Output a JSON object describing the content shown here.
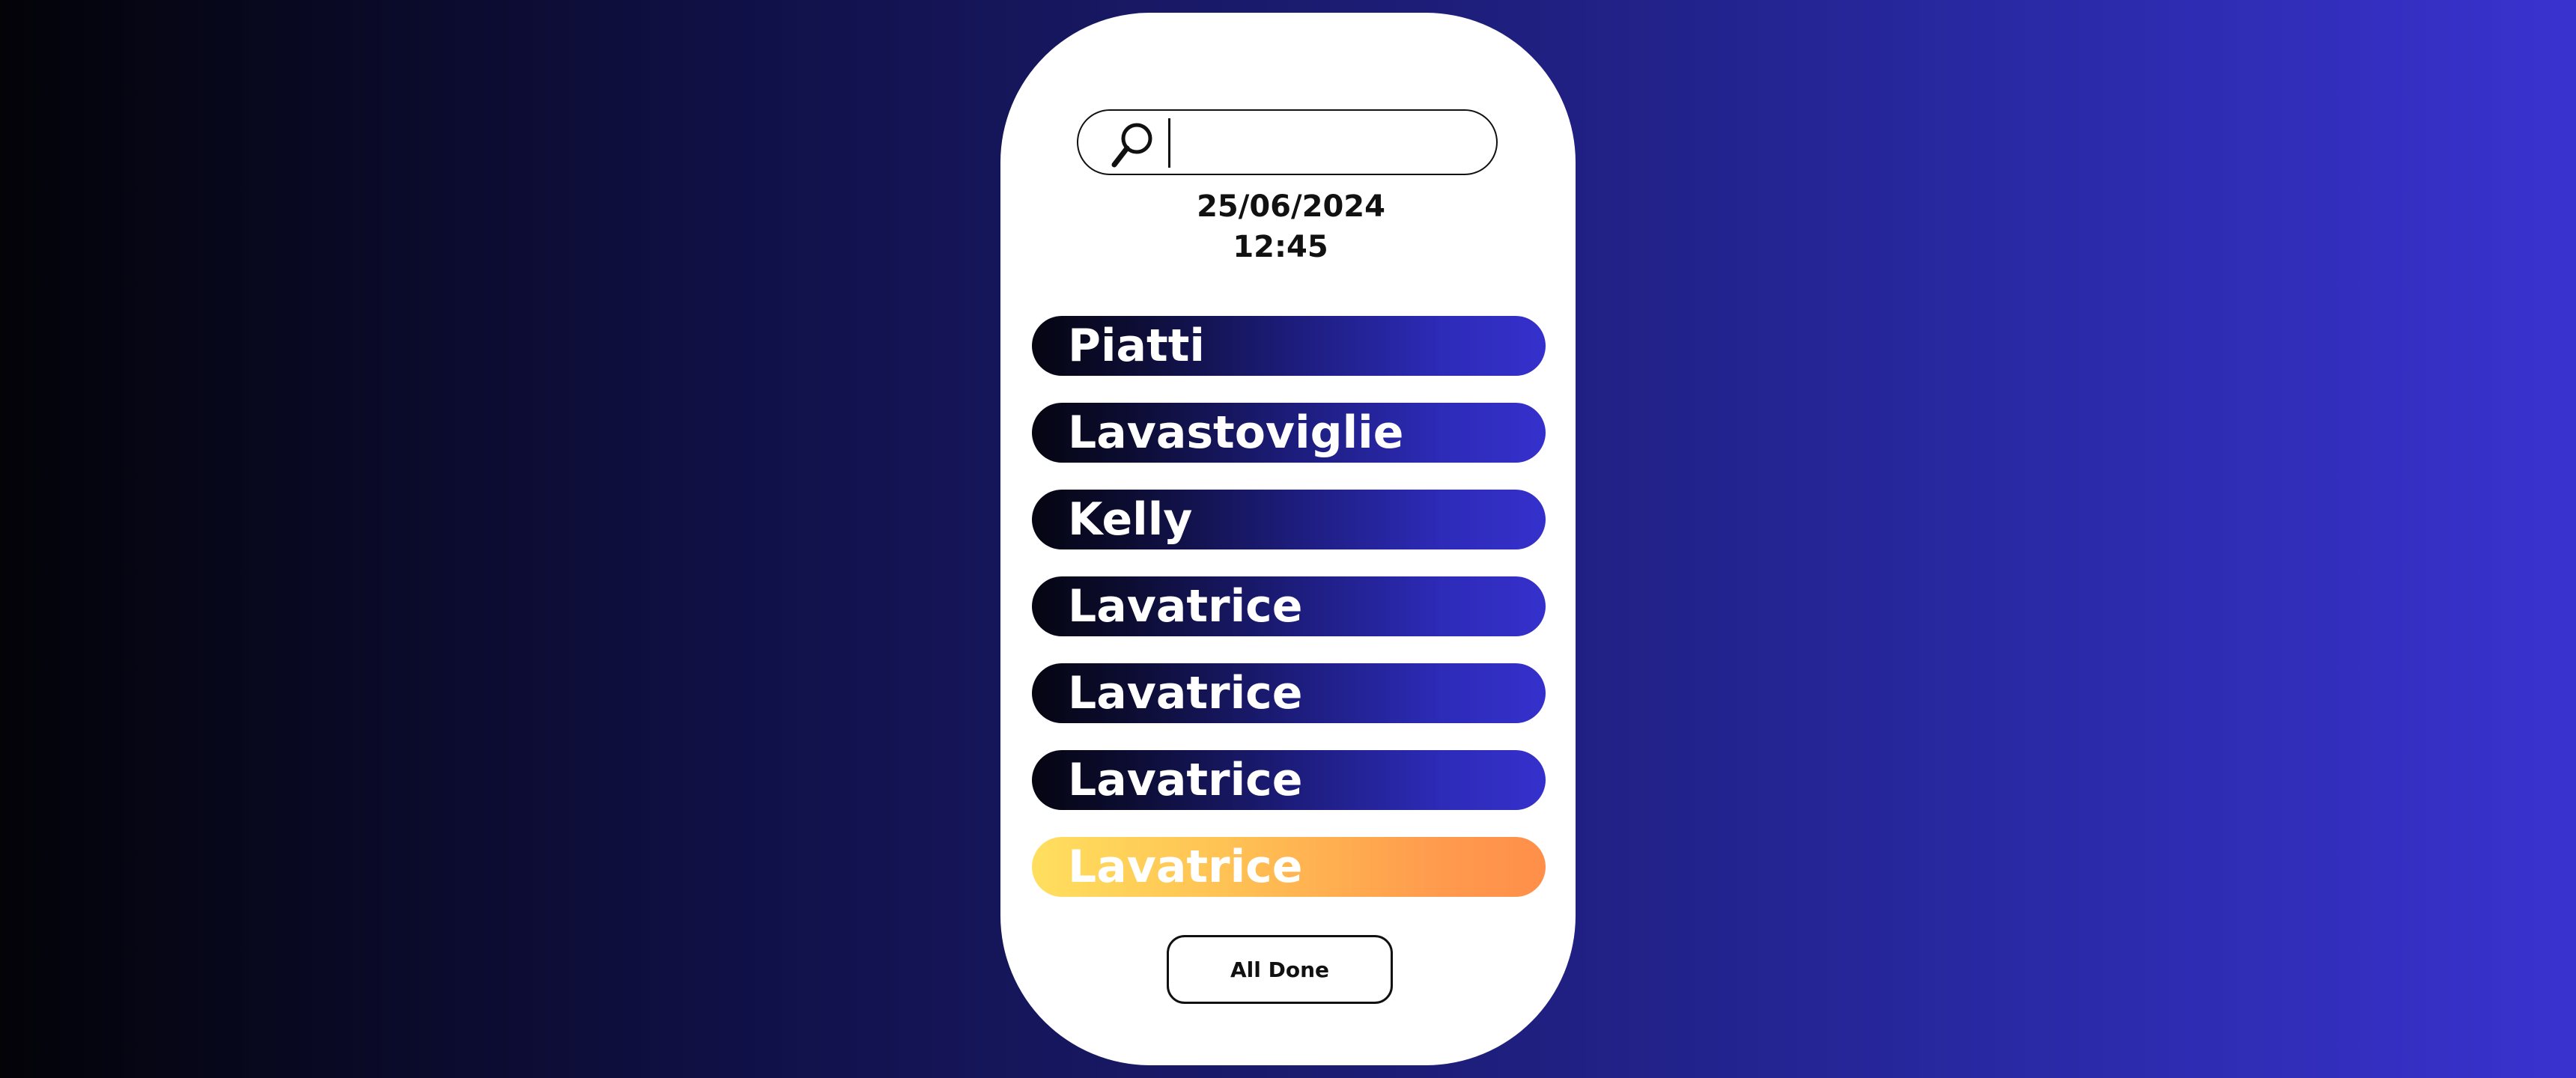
{
  "search": {
    "placeholder": "",
    "value": ""
  },
  "datetime": {
    "date": "25/06/2024",
    "time": "12:45"
  },
  "tasks": [
    {
      "label": "Piatti"
    },
    {
      "label": "Lavastoviglie"
    },
    {
      "label": "Kelly"
    },
    {
      "label": "Lavatrice"
    },
    {
      "label": "Lavatrice"
    },
    {
      "label": "Lavatrice"
    },
    {
      "label": "Lavatrice"
    }
  ],
  "all_done_label": "All Done",
  "colors": {
    "task_gradient": [
      "#050512",
      "#3530cc"
    ],
    "highlight_gradient": [
      "#ffdf5e",
      "#ff8f4a"
    ],
    "background_gradient": [
      "#030308",
      "#3a32cf"
    ]
  },
  "icons": {
    "search": "search-icon"
  }
}
